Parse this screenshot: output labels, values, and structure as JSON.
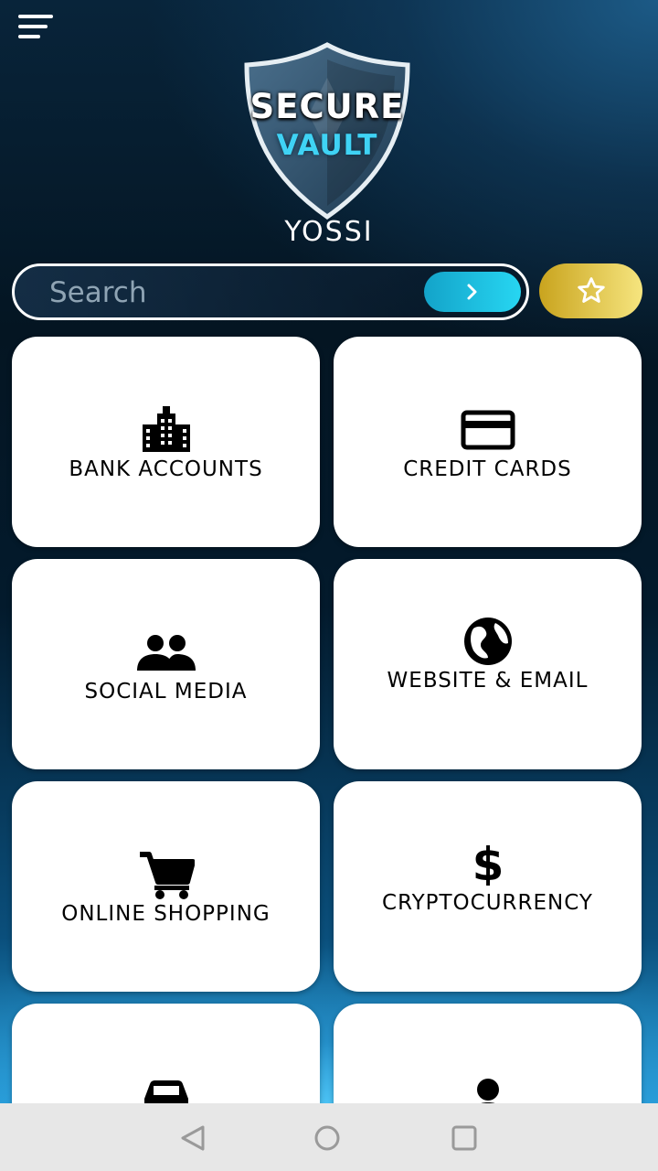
{
  "app": {
    "logo_line1": "SECURE",
    "logo_line2": "VAULT",
    "user_name": "YOSSI"
  },
  "search": {
    "placeholder": "Search"
  },
  "categories": [
    {
      "label": "BANK ACCOUNTS",
      "icon": "bank-building-icon"
    },
    {
      "label": "CREDIT CARDS",
      "icon": "credit-card-icon"
    },
    {
      "label": "SOCIAL MEDIA",
      "icon": "people-icon"
    },
    {
      "label": "WEBSITE & EMAIL",
      "icon": "globe-icon"
    },
    {
      "label": "ONLINE SHOPPING",
      "icon": "shopping-cart-icon"
    },
    {
      "label": "CRYPTOCURRENCY",
      "icon": "dollar-icon"
    },
    {
      "label": "",
      "icon": "car-icon"
    },
    {
      "label": "",
      "icon": "person-icon"
    }
  ],
  "colors": {
    "accent_cyan": "#27d6f2",
    "accent_gold": "#e8c94a",
    "card_bg": "#ffffff",
    "navbar_bg": "#e7e7e7"
  }
}
